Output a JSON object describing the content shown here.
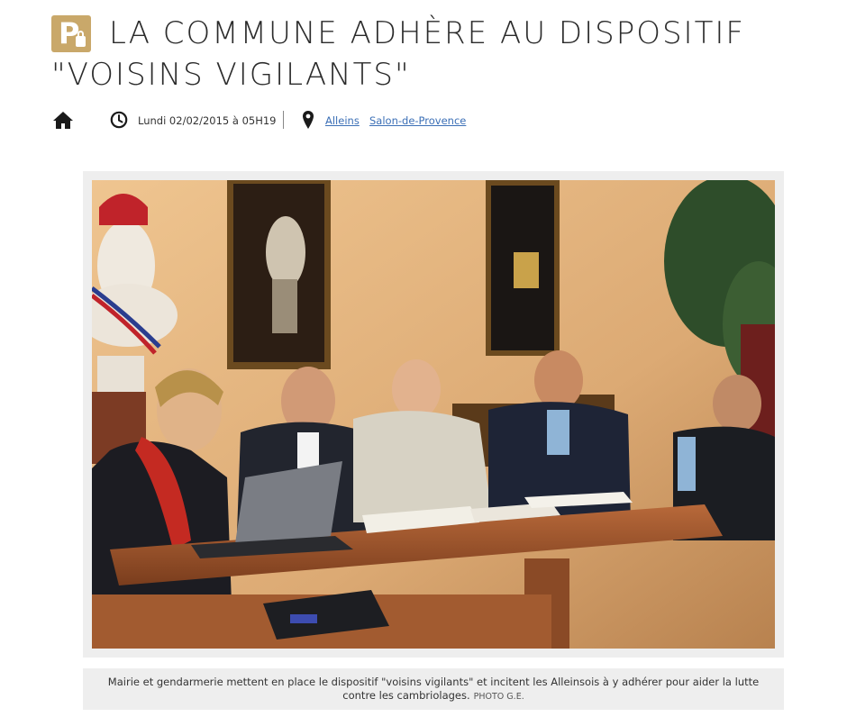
{
  "article": {
    "title": "LA COMMUNE ADHÈRE AU DISPOSITIF \"VOISINS VIGILANTS\"",
    "date": "Lundi 02/02/2015 à 05H19",
    "locations": [
      "Alleins",
      "Salon-de-Provence"
    ]
  },
  "photo": {
    "caption": "Mairie et gendarmerie mettent en place le dispositif \"voisins vigilants\" et incitent les Alleinsois à y adhérer pour aider la lutte contre les cambriolages.",
    "credit": "PHOTO G.E."
  },
  "icons": {
    "logo": "premium-lock-logo",
    "home": "home-icon",
    "clock": "clock-icon",
    "location": "map-pin-icon"
  },
  "colors": {
    "logo_gold": "#c9a86a",
    "link_blue": "#3b6fb6",
    "frame_gray": "#eeeeee"
  }
}
